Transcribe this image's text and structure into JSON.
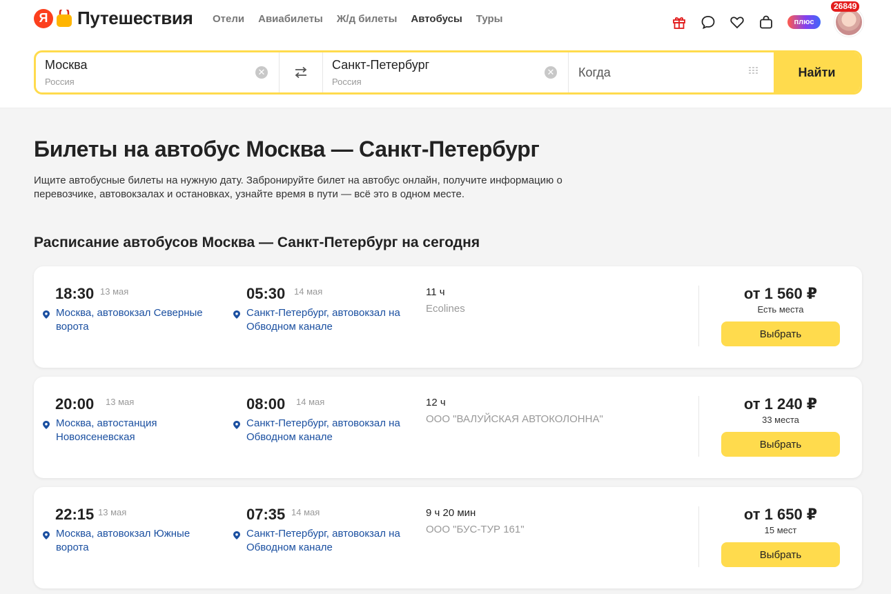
{
  "header": {
    "logo_text": "Путешествия",
    "logo_letter": "Я",
    "nav": [
      {
        "label": "Отели",
        "active": false
      },
      {
        "label": "Авиабилеты",
        "active": false
      },
      {
        "label": "Ж/д билеты",
        "active": false
      },
      {
        "label": "Автобусы",
        "active": true
      },
      {
        "label": "Туры",
        "active": false
      }
    ],
    "icons": [
      "gift-icon",
      "chat-icon",
      "heart-icon",
      "bag-icon"
    ],
    "plus_label": "плюс",
    "avatar_count": "26849"
  },
  "search": {
    "from_value": "Москва",
    "from_country": "Россия",
    "to_value": "Санкт-Петербург",
    "to_country": "Россия",
    "when_placeholder": "Когда",
    "find_label": "Найти"
  },
  "page": {
    "title": "Билеты на автобус Москва — Санкт-Петербург",
    "description": "Ищите автобусные билеты на нужную дату. Забронируйте билет на автобус онлайн, получите информацию о перевозчике, автовокзалах и остановках, узнайте время в пути — всё это в одном месте.",
    "schedule_title": "Расписание автобусов Москва — Санкт-Петербург на сегодня"
  },
  "trips": [
    {
      "dep_time": "18:30",
      "dep_date": "13 мая",
      "dep_stop_1": "Москва, автовокзал Северные",
      "dep_stop_2": "ворота",
      "arr_time": "05:30",
      "arr_date": "14 мая",
      "arr_stop_1": "Санкт-Петербург, автовокзал на",
      "arr_stop_2": "Обводном канале",
      "duration": "11 ч",
      "carrier": "Ecolines",
      "price": "от 1 560 ₽",
      "seats": "Есть места",
      "button": "Выбрать"
    },
    {
      "dep_time": "20:00",
      "dep_date": "13 мая",
      "dep_stop_1": "Москва, автостанция",
      "dep_stop_2": "Новоясеневская",
      "arr_time": "08:00",
      "arr_date": "14 мая",
      "arr_stop_1": "Санкт-Петербург, автовокзал на",
      "arr_stop_2": "Обводном канале",
      "duration": "12 ч",
      "carrier": "ООО \"ВАЛУЙСКАЯ АВТОКОЛОННА\"",
      "price": "от 1 240 ₽",
      "seats": "33 места",
      "button": "Выбрать"
    },
    {
      "dep_time": "22:15",
      "dep_date": "13 мая",
      "dep_stop_1": "Москва, автовокзал Южные",
      "dep_stop_2": "ворота",
      "arr_time": "07:35",
      "arr_date": "14 мая",
      "arr_stop_1": "Санкт-Петербург, автовокзал на",
      "arr_stop_2": "Обводном канале",
      "duration": "9 ч 20 мин",
      "carrier": "ООО \"БУС-ТУР 161\"",
      "price": "от 1 650 ₽",
      "seats": "15 мест",
      "button": "Выбрать"
    }
  ],
  "colors": {
    "accent_yellow": "#ffdb4d",
    "link_blue": "#1a4fa0",
    "logo_red": "#fc3f1d"
  }
}
